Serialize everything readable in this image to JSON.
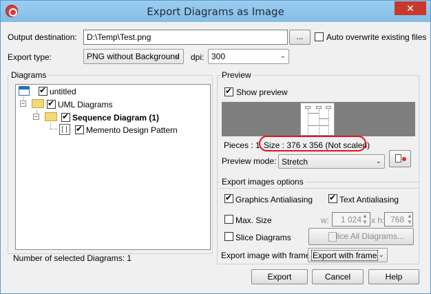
{
  "window": {
    "title": "Export Diagrams as Image",
    "close_glyph": "✕"
  },
  "output": {
    "label": "Output destination:",
    "value": "D:\\Temp\\Test.png",
    "browse_label": "...",
    "auto_overwrite_label": "Auto overwrite existing files",
    "auto_overwrite_checked": false
  },
  "export_type": {
    "label": "Export type:",
    "value": "PNG without Background"
  },
  "dpi": {
    "label": "dpi:",
    "value": "300"
  },
  "diagrams": {
    "group_title": "Diagrams",
    "tree": [
      {
        "label": "untitled",
        "checked": true,
        "bold": false
      },
      {
        "label": "UML Diagrams",
        "checked": true,
        "bold": false
      },
      {
        "label": "Sequence Diagram (1)",
        "checked": true,
        "bold": true
      },
      {
        "label": "Memento Design Pattern",
        "checked": true,
        "bold": false
      }
    ],
    "selected_count_label": "Number of selected Diagrams: 1"
  },
  "preview": {
    "group_title": "Preview",
    "show_preview_label": "Show preview",
    "show_preview_checked": true,
    "pieces_label": "Pieces : 1",
    "size_label": "Size : 376 x 356 (Not scaled)",
    "mode_label": "Preview mode:",
    "mode_value": "Stretch"
  },
  "options": {
    "group_title": "Export images options",
    "graphics_aa_label": "Graphics Antialiasing",
    "graphics_aa_checked": true,
    "text_aa_label": "Text Antialiasing",
    "text_aa_checked": true,
    "max_size_label": "Max. Size",
    "max_size_checked": false,
    "w_label": "w:",
    "w_value": "1 024",
    "h_label": "x h:",
    "h_value": "768",
    "slice_label": "Slice Diagrams",
    "slice_checked": false,
    "slice_all_label": "Slice All Diagrams...",
    "frame_label": "Export image with frame :",
    "frame_value": "Export with frame"
  },
  "buttons": {
    "export": "Export",
    "cancel": "Cancel",
    "help": "Help"
  }
}
